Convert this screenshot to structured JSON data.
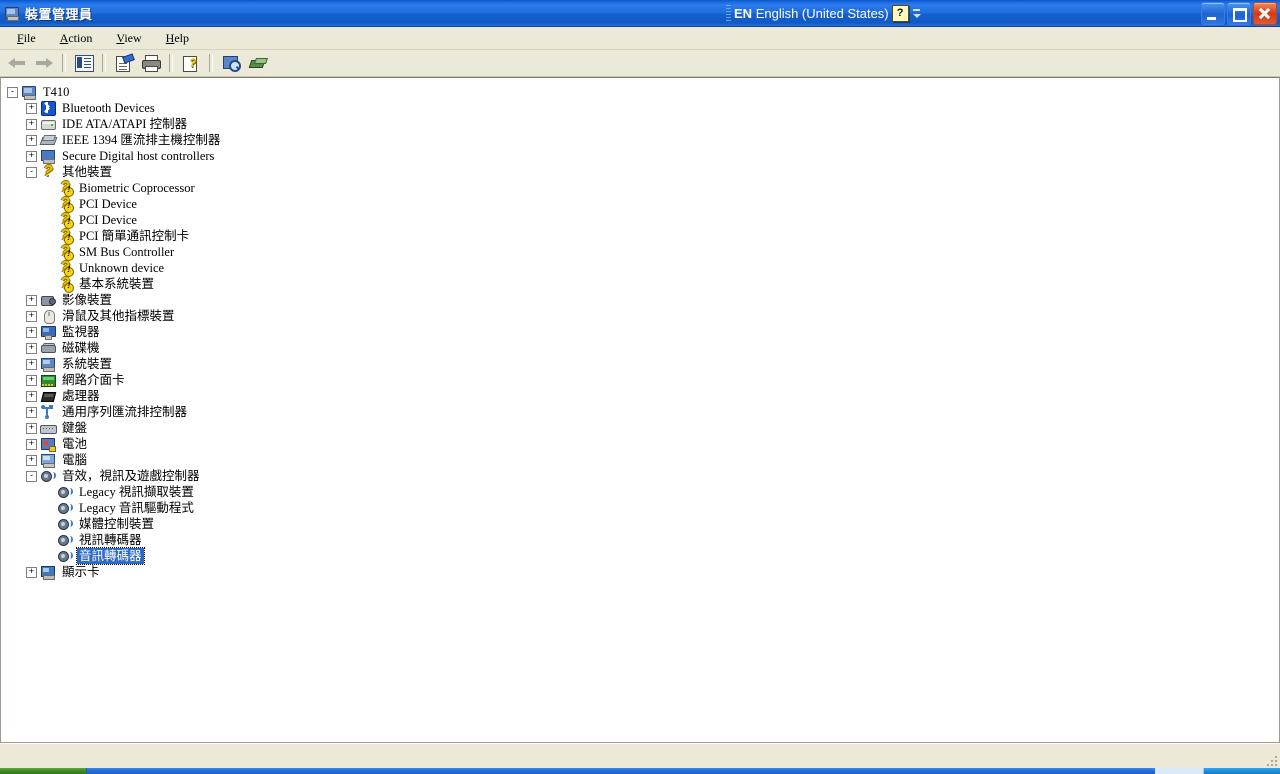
{
  "window": {
    "title": "裝置管理員",
    "title_icon": "computer-icon"
  },
  "language_bar": {
    "code": "EN",
    "name": "English (United States)",
    "help_glyph": "?"
  },
  "window_controls": {
    "minimize": "minimize-button",
    "restore": "restore-button",
    "close": "close-button"
  },
  "menubar": {
    "items": [
      {
        "label": "File",
        "accel": "F"
      },
      {
        "label": "Action",
        "accel": "A"
      },
      {
        "label": "View",
        "accel": "V"
      },
      {
        "label": "Help",
        "accel": "H"
      }
    ]
  },
  "toolbar": {
    "buttons": [
      {
        "name": "back-button",
        "icon": "back-arrow-icon"
      },
      {
        "name": "forward-button",
        "icon": "forward-arrow-icon"
      },
      {
        "name": "show-hide-tree-button",
        "icon": "console-tree-icon"
      },
      {
        "name": "properties-button",
        "icon": "properties-icon"
      },
      {
        "name": "print-button",
        "icon": "printer-icon"
      },
      {
        "name": "help-button",
        "icon": "help-icon"
      },
      {
        "name": "scan-hardware-changes-button",
        "icon": "scan-monitor-icon"
      },
      {
        "name": "update-driver-button",
        "icon": "device-green-icon"
      }
    ]
  },
  "tree": {
    "nodes": [
      {
        "label": "T410",
        "depth": 0,
        "expander": "-",
        "icon": "computer-icon",
        "selected": false
      },
      {
        "label": "Bluetooth Devices",
        "depth": 1,
        "expander": "+",
        "icon": "bluetooth-icon",
        "selected": false
      },
      {
        "label": "IDE ATA/ATAPI 控制器",
        "depth": 1,
        "expander": "+",
        "icon": "ide-controller-icon",
        "selected": false
      },
      {
        "label": "IEEE 1394 匯流排主機控制器",
        "depth": 1,
        "expander": "+",
        "icon": "ieee1394-icon",
        "selected": false
      },
      {
        "label": "Secure Digital host controllers",
        "depth": 1,
        "expander": "+",
        "icon": "sd-host-icon",
        "selected": false
      },
      {
        "label": "其他裝置",
        "depth": 1,
        "expander": "-",
        "icon": "unknown-device-icon",
        "selected": false
      },
      {
        "label": "Biometric Coprocessor",
        "depth": 2,
        "expander": "",
        "icon": "unknown-device-warning-icon",
        "selected": false
      },
      {
        "label": "PCI Device",
        "depth": 2,
        "expander": "",
        "icon": "unknown-device-warning-icon",
        "selected": false
      },
      {
        "label": "PCI Device",
        "depth": 2,
        "expander": "",
        "icon": "unknown-device-warning-icon",
        "selected": false
      },
      {
        "label": "PCI 簡單通訊控制卡",
        "depth": 2,
        "expander": "",
        "icon": "unknown-device-warning-icon",
        "selected": false
      },
      {
        "label": "SM Bus Controller",
        "depth": 2,
        "expander": "",
        "icon": "unknown-device-warning-icon",
        "selected": false
      },
      {
        "label": "Unknown device",
        "depth": 2,
        "expander": "",
        "icon": "unknown-device-warning-icon",
        "selected": false
      },
      {
        "label": "基本系統裝置",
        "depth": 2,
        "expander": "",
        "icon": "unknown-device-warning-icon",
        "selected": false
      },
      {
        "label": "影像裝置",
        "depth": 1,
        "expander": "+",
        "icon": "imaging-device-icon",
        "selected": false
      },
      {
        "label": "滑鼠及其他指標裝置",
        "depth": 1,
        "expander": "+",
        "icon": "mouse-icon",
        "selected": false
      },
      {
        "label": "監視器",
        "depth": 1,
        "expander": "+",
        "icon": "monitor-icon",
        "selected": false
      },
      {
        "label": "磁碟機",
        "depth": 1,
        "expander": "+",
        "icon": "disk-drive-icon",
        "selected": false
      },
      {
        "label": "系統裝置",
        "depth": 1,
        "expander": "+",
        "icon": "system-device-icon",
        "selected": false
      },
      {
        "label": "網路介面卡",
        "depth": 1,
        "expander": "+",
        "icon": "network-adapter-icon",
        "selected": false
      },
      {
        "label": "處理器",
        "depth": 1,
        "expander": "+",
        "icon": "processor-icon",
        "selected": false
      },
      {
        "label": "通用序列匯流排控制器",
        "depth": 1,
        "expander": "+",
        "icon": "usb-controller-icon",
        "selected": false
      },
      {
        "label": "鍵盤",
        "depth": 1,
        "expander": "+",
        "icon": "keyboard-icon",
        "selected": false
      },
      {
        "label": "電池",
        "depth": 1,
        "expander": "+",
        "icon": "battery-icon",
        "selected": false
      },
      {
        "label": "電腦",
        "depth": 1,
        "expander": "+",
        "icon": "computer-node-icon",
        "selected": false
      },
      {
        "label": "音效，視訊及遊戲控制器",
        "depth": 1,
        "expander": "-",
        "icon": "sound-video-game-icon",
        "selected": false
      },
      {
        "label": "Legacy 視訊擷取裝置",
        "depth": 2,
        "expander": "",
        "icon": "sound-device-icon",
        "selected": false
      },
      {
        "label": "Legacy 音訊驅動程式",
        "depth": 2,
        "expander": "",
        "icon": "sound-device-icon",
        "selected": false
      },
      {
        "label": "媒體控制裝置",
        "depth": 2,
        "expander": "",
        "icon": "sound-device-icon",
        "selected": false
      },
      {
        "label": "視訊轉碼器",
        "depth": 2,
        "expander": "",
        "icon": "sound-device-icon",
        "selected": false
      },
      {
        "label": "音訊轉碼器",
        "depth": 2,
        "expander": "",
        "icon": "sound-device-icon",
        "selected": true
      },
      {
        "label": "顯示卡",
        "depth": 1,
        "expander": "+",
        "icon": "display-adapter-icon",
        "selected": false
      }
    ]
  },
  "statusbar": {
    "text": ""
  },
  "taskbar": {
    "start_label": "",
    "tray_label": ""
  },
  "colors": {
    "title_blue": "#1560CF",
    "chrome_beige": "#ECE9D8",
    "selection_blue": "#316AC5",
    "warning_yellow": "#F2D21A"
  }
}
